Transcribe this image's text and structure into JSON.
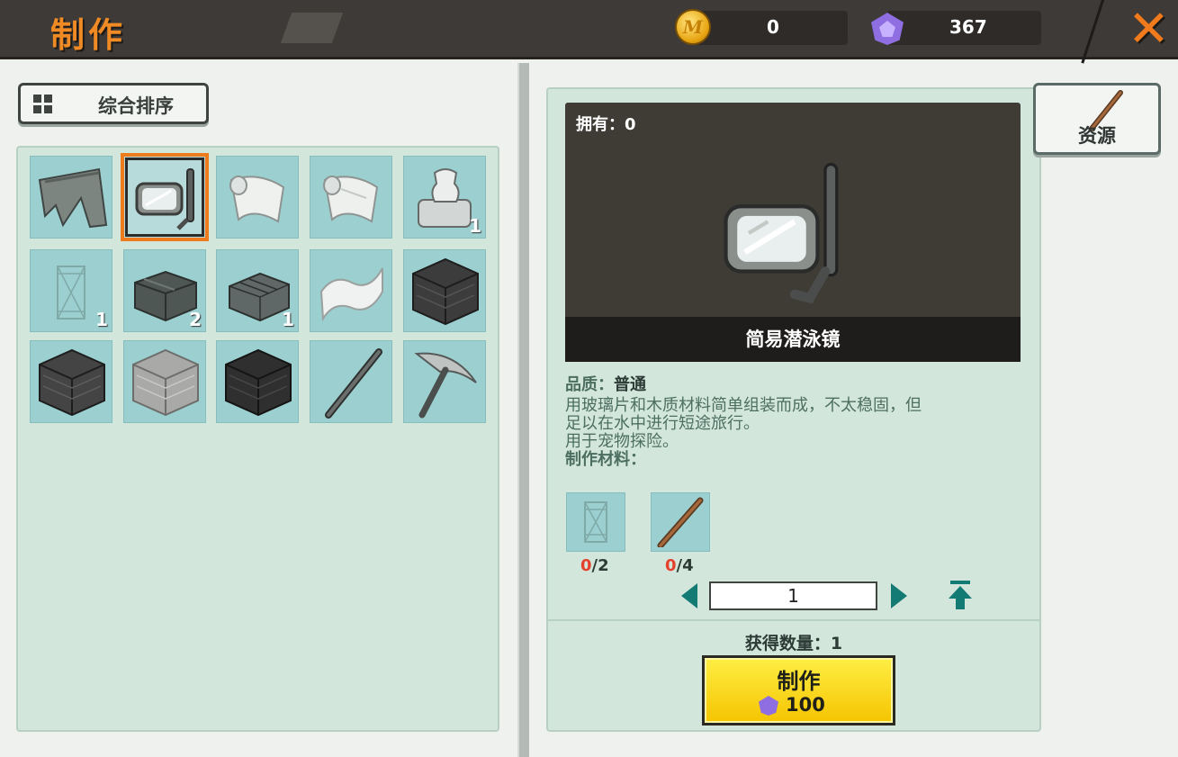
{
  "header": {
    "title": "制作",
    "coins": "0",
    "gems": "367",
    "coin_icon_letter": "M"
  },
  "sort": {
    "label": "综合排序"
  },
  "inventory": {
    "slots": [
      {
        "name": "wing-item",
        "count": ""
      },
      {
        "name": "diving-goggles-item",
        "count": ""
      },
      {
        "name": "cloth-roll-item",
        "count": ""
      },
      {
        "name": "cloth-roll-item-2",
        "count": ""
      },
      {
        "name": "pottery-item",
        "count": "1"
      },
      {
        "name": "glass-pane-item",
        "count": "1"
      },
      {
        "name": "stone-brick-item",
        "count": "2"
      },
      {
        "name": "stone-brick-item-2",
        "count": "1"
      },
      {
        "name": "paper-item",
        "count": ""
      },
      {
        "name": "dark-block-item",
        "count": ""
      },
      {
        "name": "dark-block-item-2",
        "count": ""
      },
      {
        "name": "grey-block-item",
        "count": ""
      },
      {
        "name": "dark-block-item-3",
        "count": ""
      },
      {
        "name": "stick-item",
        "count": ""
      },
      {
        "name": "pickaxe-item",
        "count": ""
      }
    ]
  },
  "detail": {
    "owned": "拥有：0",
    "item_name": "简易潜泳镜",
    "quality_label": "品质：",
    "quality_value": "普通",
    "desc_line1": "用玻璃片和木质材料简单组装而成，不太稳固，但",
    "desc_line2": "足以在水中进行短途旅行。",
    "desc_line3": "用于宠物探险。",
    "materials_label": "制作材料：",
    "materials": [
      {
        "name": "glass-pane",
        "have": "0",
        "need": "/2"
      },
      {
        "name": "wooden-stick",
        "have": "0",
        "need": "/4"
      }
    ],
    "quantity": "1",
    "gain_text": "获得数量：1",
    "craft_label": "制作",
    "craft_cost": "100"
  },
  "resource_button": {
    "label": "资源"
  },
  "colors": {
    "accent_orange": "#f08a24",
    "panel_green": "#d3e6dc",
    "slot_teal": "#9ccfcf",
    "craft_yellow": "#f5c400",
    "shortage_red": "#e5402c"
  }
}
